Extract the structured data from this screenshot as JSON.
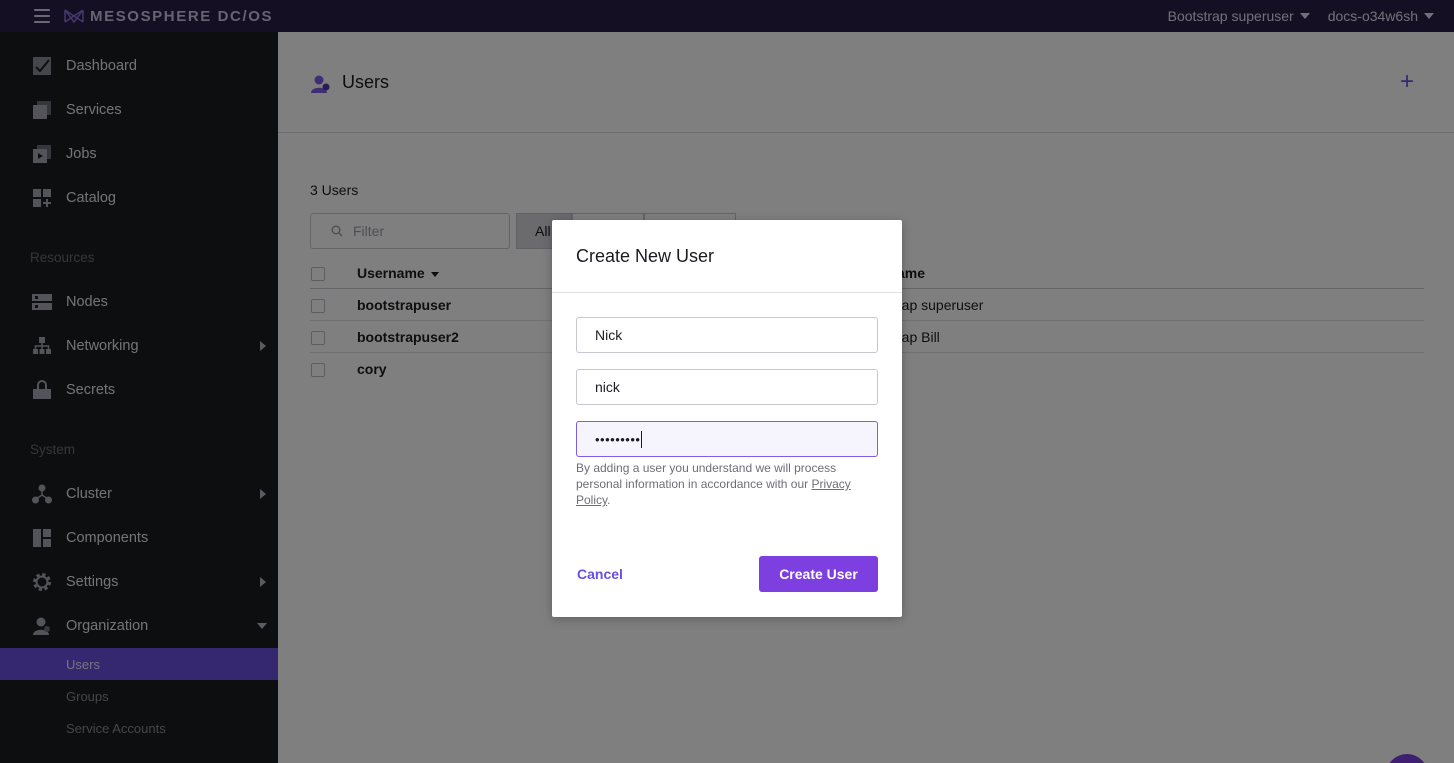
{
  "topbar": {
    "brand": "MESOSPHERE DC/OS",
    "user_menu": "Bootstrap superuser",
    "cluster_menu": "docs-o34w6sh"
  },
  "sidebar": {
    "items": [
      {
        "label": "Dashboard",
        "icon": "dashboard-icon"
      },
      {
        "label": "Services",
        "icon": "services-icon"
      },
      {
        "label": "Jobs",
        "icon": "jobs-icon"
      },
      {
        "label": "Catalog",
        "icon": "catalog-icon"
      }
    ],
    "resources_label": "Resources",
    "resources": [
      {
        "label": "Nodes",
        "icon": "nodes-icon"
      },
      {
        "label": "Networking",
        "icon": "networking-icon"
      },
      {
        "label": "Secrets",
        "icon": "secrets-icon"
      }
    ],
    "system_label": "System",
    "system": [
      {
        "label": "Cluster",
        "icon": "cluster-icon"
      },
      {
        "label": "Components",
        "icon": "components-icon"
      },
      {
        "label": "Settings",
        "icon": "settings-icon"
      },
      {
        "label": "Organization",
        "icon": "organization-icon"
      }
    ],
    "org_sub": [
      {
        "label": "Users",
        "active": true
      },
      {
        "label": "Groups"
      },
      {
        "label": "Service Accounts"
      }
    ]
  },
  "page": {
    "title": "Users",
    "count": "3 Users",
    "filter_placeholder": "Filter",
    "seg_all": "All"
  },
  "table": {
    "headers": {
      "username": "Username",
      "description": "ame"
    },
    "rows": [
      {
        "username": "bootstrapuser",
        "description": "rap superuser"
      },
      {
        "username": "bootstrapuser2",
        "description": "rap Bill"
      },
      {
        "username": "cory",
        "description": ""
      }
    ]
  },
  "modal": {
    "title": "Create New User",
    "full_name": "Nick",
    "username": "nick",
    "password_mask": "•••••••••",
    "notice_text": "By adding a user you understand we will process personal information in accordance with our ",
    "notice_link": "Privacy Policy",
    "notice_end": ".",
    "cancel_label": "Cancel",
    "create_label": "Create User"
  },
  "colors": {
    "accent": "#6b4fe0",
    "topbar": "#2a1f47",
    "sidebar": "#1b1c21"
  }
}
